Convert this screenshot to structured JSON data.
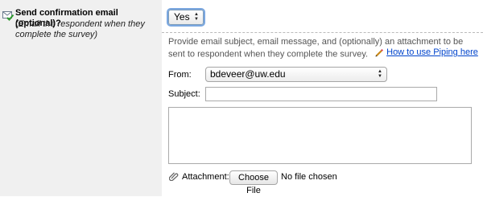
{
  "question": {
    "title": "Send confirmation email (optional)?",
    "note": "(Email the respondent when they complete the survey)",
    "icon": "email-check-icon"
  },
  "send_select": {
    "value": "Yes"
  },
  "description": "Provide email subject, email message, and (optionally) an attachment to be sent to respondent when they complete the survey.",
  "piping": {
    "link_text": "How to use Piping here",
    "icon": "pencil-icon"
  },
  "from": {
    "label": "From:",
    "value": "bdeveer@uw.edu"
  },
  "subject": {
    "label": "Subject:",
    "value": ""
  },
  "message": {
    "value": ""
  },
  "attachment": {
    "label": "Attachment:",
    "button_label": "Choose File",
    "status": "No file chosen",
    "icon": "paperclip-icon"
  },
  "colors": {
    "link": "#0044cc",
    "left_panel": "#f0f0f0",
    "focus_ring": "#7aa7e0"
  }
}
